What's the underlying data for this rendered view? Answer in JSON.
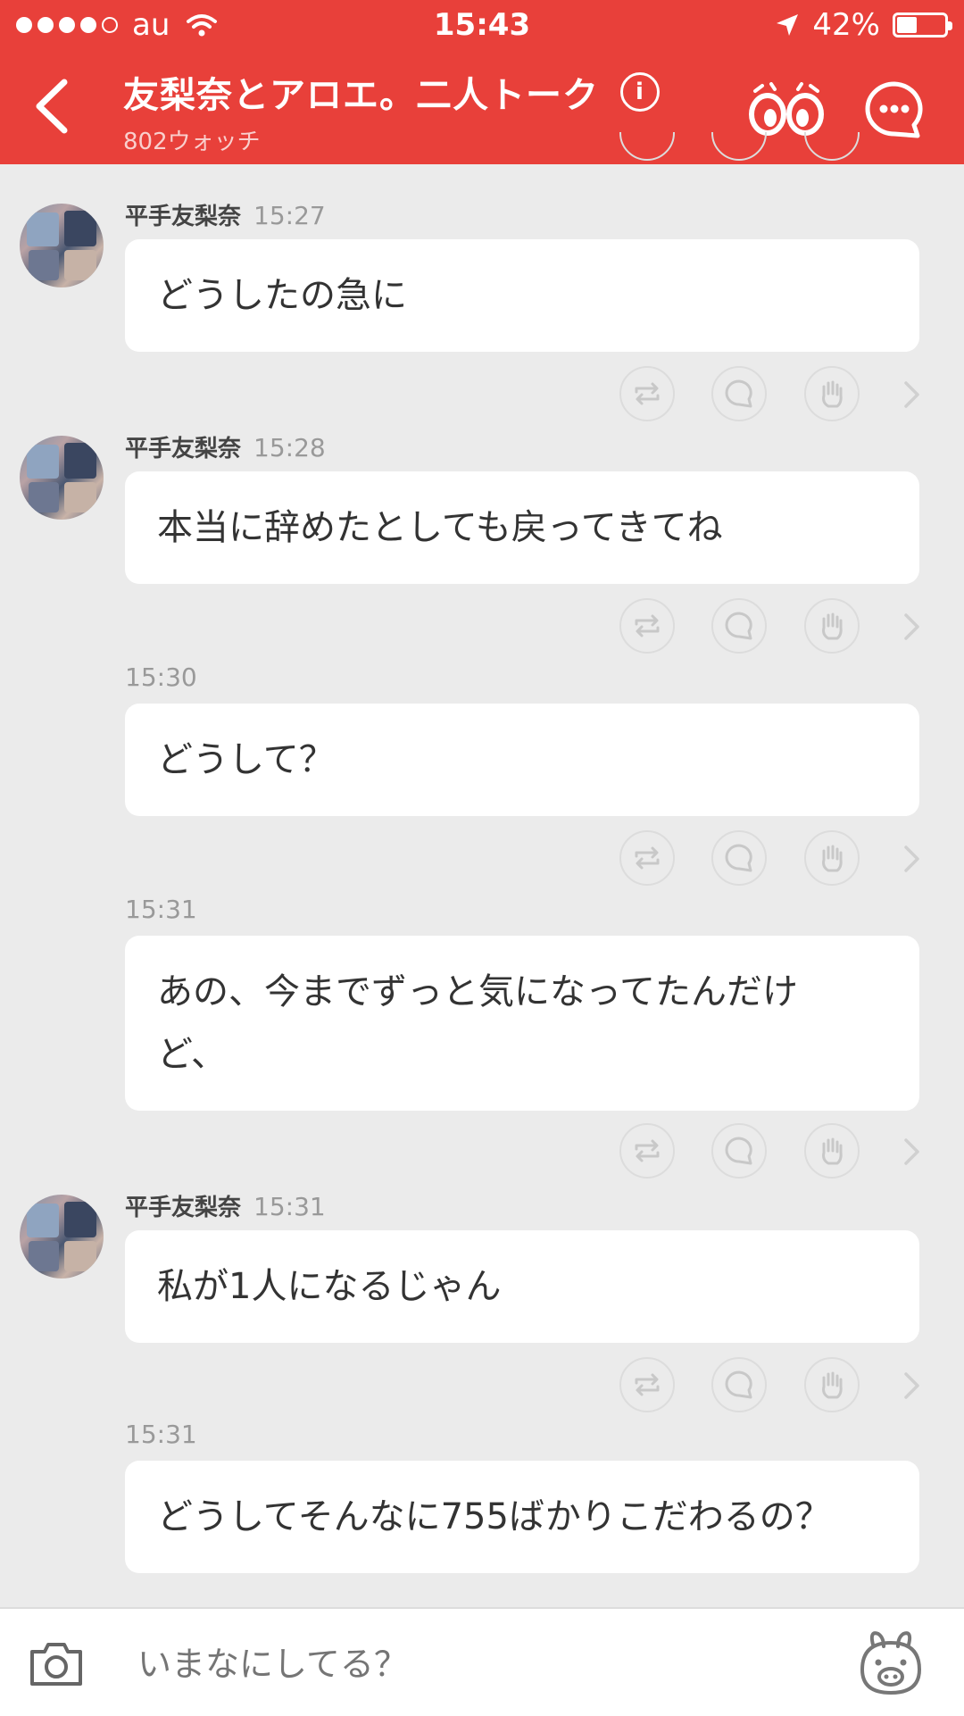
{
  "status_bar": {
    "carrier": "au",
    "time": "15:43",
    "battery": "42%"
  },
  "header": {
    "title": "友梨奈とアロエ。二人トーク",
    "subtitle": "802ウォッチ"
  },
  "messages": [
    {
      "sender": "平手友梨奈",
      "time": "15:27",
      "text": "どうしたの急に"
    },
    {
      "sender": "平手友梨奈",
      "time": "15:28",
      "text": "本当に辞めたとしても戻ってきてね"
    },
    {
      "sender": "",
      "time": "15:30",
      "text": "どうして？"
    },
    {
      "sender": "",
      "time": "15:31",
      "text": "あの、今までずっと気になってたんだけど、"
    },
    {
      "sender": "平手友梨奈",
      "time": "15:31",
      "text": "私が1人になるじゃん"
    },
    {
      "sender": "",
      "time": "15:31",
      "text": "どうしてそんなに755ばかりこだわるの？"
    }
  ],
  "input": {
    "placeholder": "いまなにしてる？"
  },
  "colors": {
    "header": "#e8403a",
    "background": "#ebebeb",
    "bubble": "#ffffff"
  },
  "icons": [
    "back-arrow-icon",
    "info-icon",
    "watch-eyes-icon",
    "chat-menu-icon",
    "repost-icon",
    "comment-icon",
    "clap-icon",
    "chevron-right-icon",
    "camera-icon",
    "bear-stamp-icon"
  ]
}
